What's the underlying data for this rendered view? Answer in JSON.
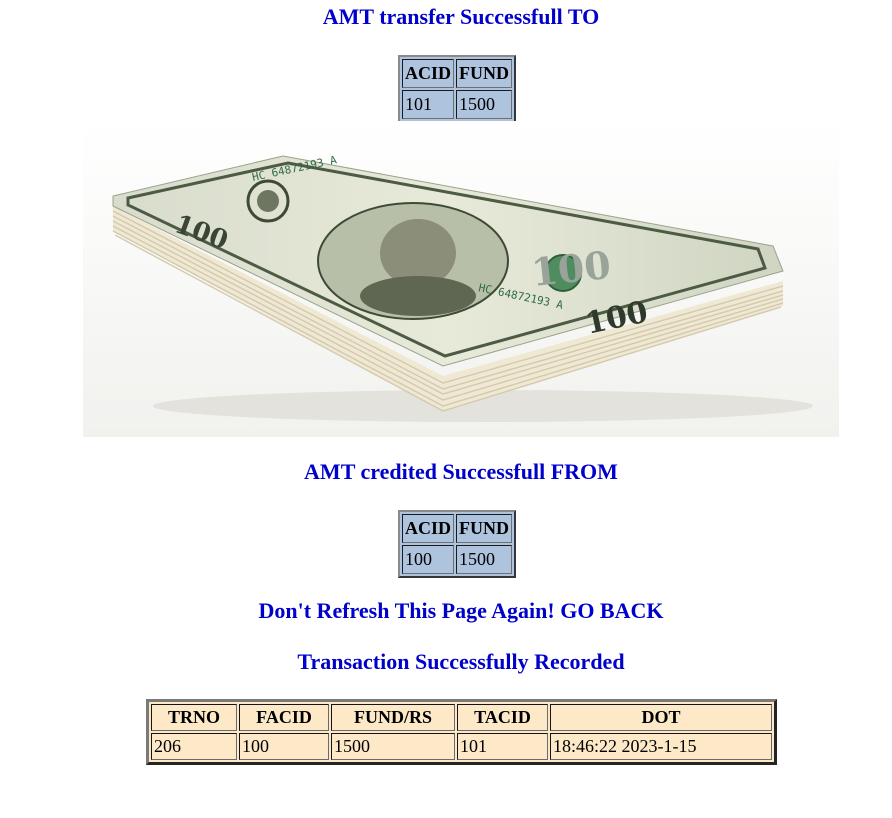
{
  "to_section": {
    "heading": "AMT transfer Successfull TO",
    "headers": [
      "ACID",
      "FUND"
    ],
    "row": [
      "101",
      "1500"
    ]
  },
  "image": {
    "icon": "money-stack-icon",
    "bill_serial": "HC 64872193 A",
    "bill_denomination": "100"
  },
  "from_section": {
    "heading": "AMT credited Successfull FROM",
    "headers": [
      "ACID",
      "FUND"
    ],
    "row": [
      "100",
      "1500"
    ]
  },
  "warning": "Don't Refresh This Page Again! GO BACK",
  "recorded": "Transaction Successfully Recorded",
  "transaction": {
    "headers": [
      "TRNO",
      "FACID",
      "FUND/RS",
      "TACID",
      "DOT"
    ],
    "row": [
      "206",
      "100",
      "1500",
      "101",
      "18:46:22 2023-1-15"
    ]
  },
  "colors": {
    "heading": "#0000cc",
    "account_table_bg": "#aec3dd",
    "transaction_table_bg": "#fde9c8"
  }
}
